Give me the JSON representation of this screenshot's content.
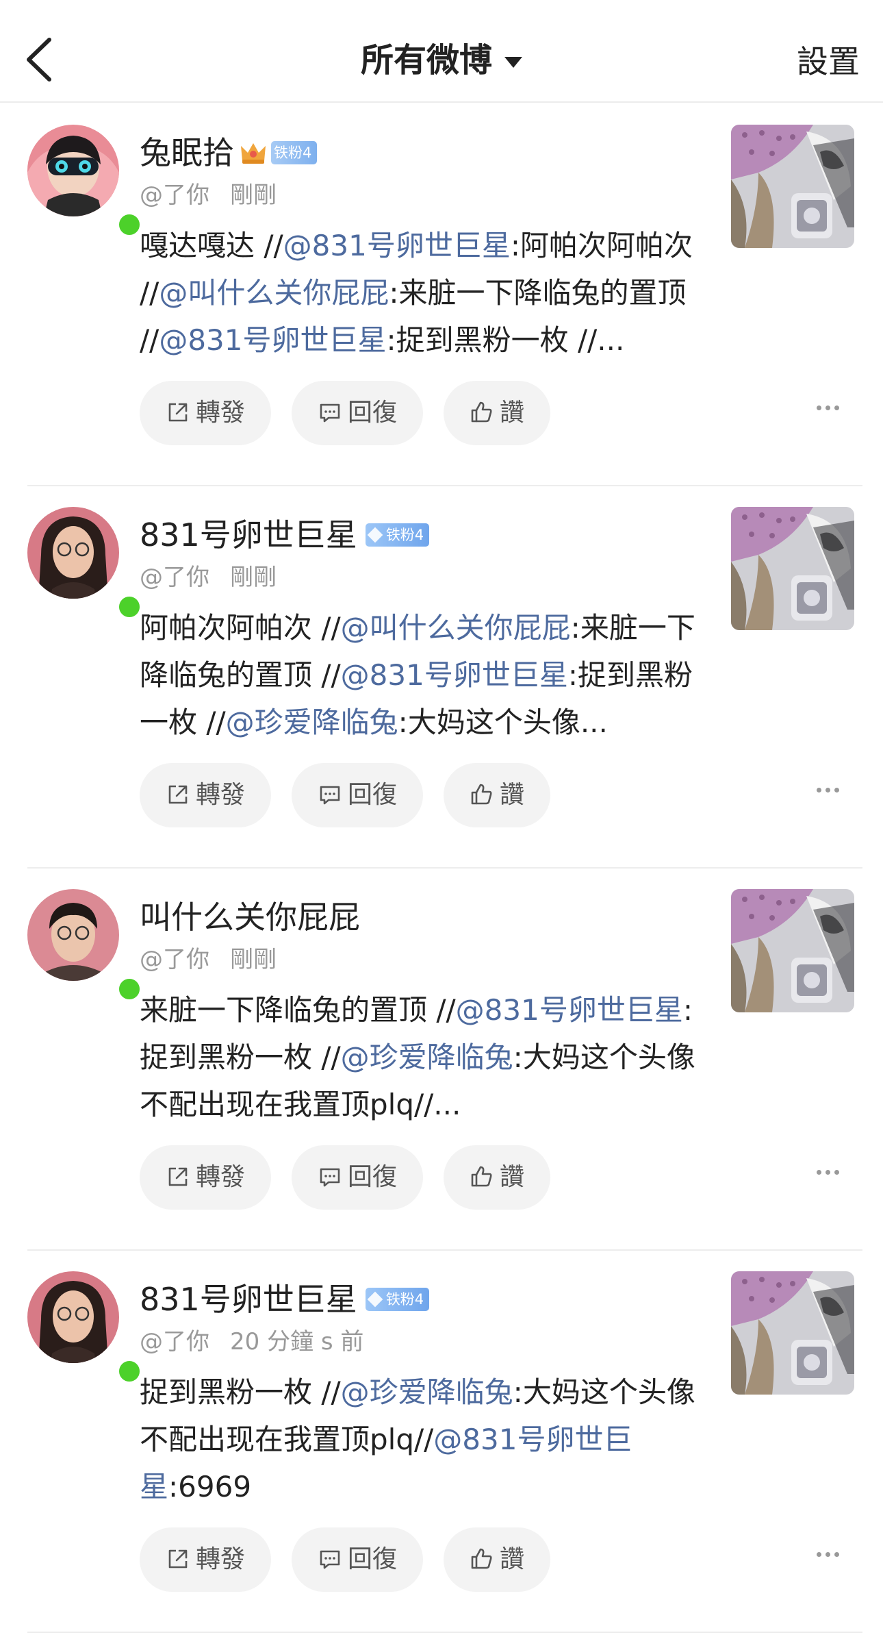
{
  "header": {
    "title": "所有微博",
    "settings_label": "設置"
  },
  "actions": {
    "repost": "轉發",
    "reply": "回復",
    "like": "讚"
  },
  "posts": [
    {
      "username": "兔眠拾",
      "badge": "铁粉4",
      "badge_type": "crown",
      "mention_line": "@了你",
      "time": "剛剛",
      "segments": [
        {
          "t": "嘎达嘎达 //"
        },
        {
          "t": "@831号卵世巨星",
          "m": true
        },
        {
          "t": ":阿帕次阿帕次 //"
        },
        {
          "t": "@叫什么关你屁屁",
          "m": true
        },
        {
          "t": ":来脏一下降临兔的置顶 //"
        },
        {
          "t": "@831号卵世巨星",
          "m": true
        },
        {
          "t": ":捉到黑粉一枚 //..."
        }
      ]
    },
    {
      "username": "831号卵世巨星",
      "badge": "铁粉4",
      "badge_type": "gem",
      "mention_line": "@了你",
      "time": "剛剛",
      "segments": [
        {
          "t": "阿帕次阿帕次 //"
        },
        {
          "t": "@叫什么关你屁屁",
          "m": true
        },
        {
          "t": ":来脏一下降临兔的置顶 //"
        },
        {
          "t": "@831号卵世巨星",
          "m": true
        },
        {
          "t": ":捉到黑粉一枚 //"
        },
        {
          "t": "@珍爱降临兔",
          "m": true
        },
        {
          "t": ":大妈这个头像..."
        }
      ]
    },
    {
      "username": "叫什么关你屁屁",
      "badge": "",
      "badge_type": "none",
      "mention_line": "@了你",
      "time": "剛剛",
      "segments": [
        {
          "t": "来脏一下降临兔的置顶 //"
        },
        {
          "t": "@831号卵世巨星",
          "m": true
        },
        {
          "t": ":捉到黑粉一枚 //"
        },
        {
          "t": "@珍爱降临兔",
          "m": true
        },
        {
          "t": ":大妈这个头像不配出现在我置顶plq//..."
        }
      ]
    },
    {
      "username": "831号卵世巨星",
      "badge": "铁粉4",
      "badge_type": "gem",
      "mention_line": "@了你",
      "time": "20 分鐘 s 前",
      "segments": [
        {
          "t": "捉到黑粉一枚 //"
        },
        {
          "t": "@珍爱降临兔",
          "m": true
        },
        {
          "t": ":大妈这个头像不配出现在我置顶plq//"
        },
        {
          "t": "@831号卵世巨星",
          "m": true
        },
        {
          "t": ":6969"
        }
      ]
    }
  ],
  "colors": {
    "mention": "#4d6a9e",
    "online": "#4cd12a",
    "badge": "#7eb0ee"
  }
}
